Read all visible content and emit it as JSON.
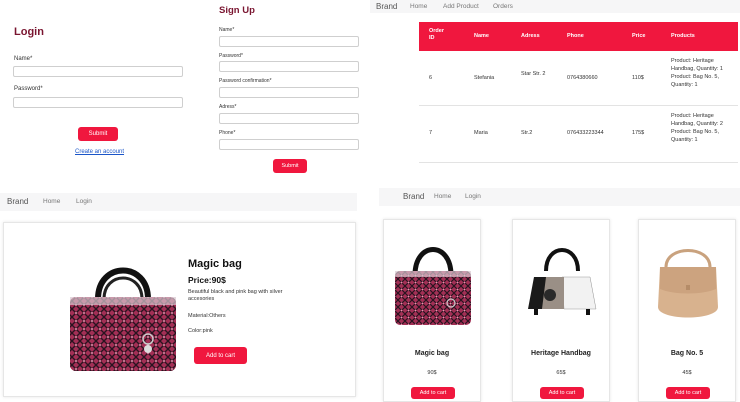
{
  "login": {
    "title": "Login",
    "name_label": "Name*",
    "password_label": "Password*",
    "submit_label": "Submit",
    "create_account_link": "Create an account"
  },
  "signup": {
    "title": "Sign Up",
    "name_label": "Name*",
    "password_label": "Password*",
    "password_confirmation_label": "Password confirmation*",
    "address_label": "Adress*",
    "phone_label": "Phone*",
    "submit_label": "Submit"
  },
  "admin_nav": {
    "brand": "Brand",
    "home": "Home",
    "add_product": "Add Product",
    "orders": "Orders"
  },
  "orders_table": {
    "headers": {
      "order_id": "Order ID",
      "name": "Name",
      "address": "Adress",
      "phone": "Phone",
      "price": "Price",
      "products": "Products"
    },
    "rows": [
      {
        "order_id": "6",
        "name": "Stefania",
        "address": "Star Str. 2",
        "phone": "0764380660",
        "price": "110$",
        "products": "Product: Heritage Handbag, Quantity: 1 Product: Bag No. 5, Quantity: 1"
      },
      {
        "order_id": "7",
        "name": "Maria",
        "address": "Str.2",
        "phone": "076433223344",
        "price": "175$",
        "products": "Product: Heritage Handbag, Quantity: 2 Product: Bag No. 5, Quantity: 1"
      }
    ]
  },
  "detail_nav": {
    "brand": "Brand",
    "home": "Home",
    "login": "Login"
  },
  "product_detail": {
    "title": "Magic bag",
    "price": "Price:90$",
    "description": "Beautiful black and pink bag with silver accesories",
    "material": "Material:Others",
    "color": "Color:pink",
    "add_to_cart": "Add to cart"
  },
  "shop_nav": {
    "brand": "Brand",
    "home": "Home",
    "login": "Login"
  },
  "products": [
    {
      "name": "Magic bag",
      "price": "90$",
      "button": "Add to cart",
      "image": "pink-tweed-handbag"
    },
    {
      "name": "Heritage Handbag",
      "price": "65$",
      "button": "Add to cart",
      "image": "black-white-handbag"
    },
    {
      "name": "Bag No. 5",
      "price": "45$",
      "button": "Add to cart",
      "image": "beige-saddle-bag"
    }
  ],
  "colors": {
    "accent": "#f0173e",
    "title": "#7a1530",
    "nav_bg": "#f6f6f7"
  }
}
